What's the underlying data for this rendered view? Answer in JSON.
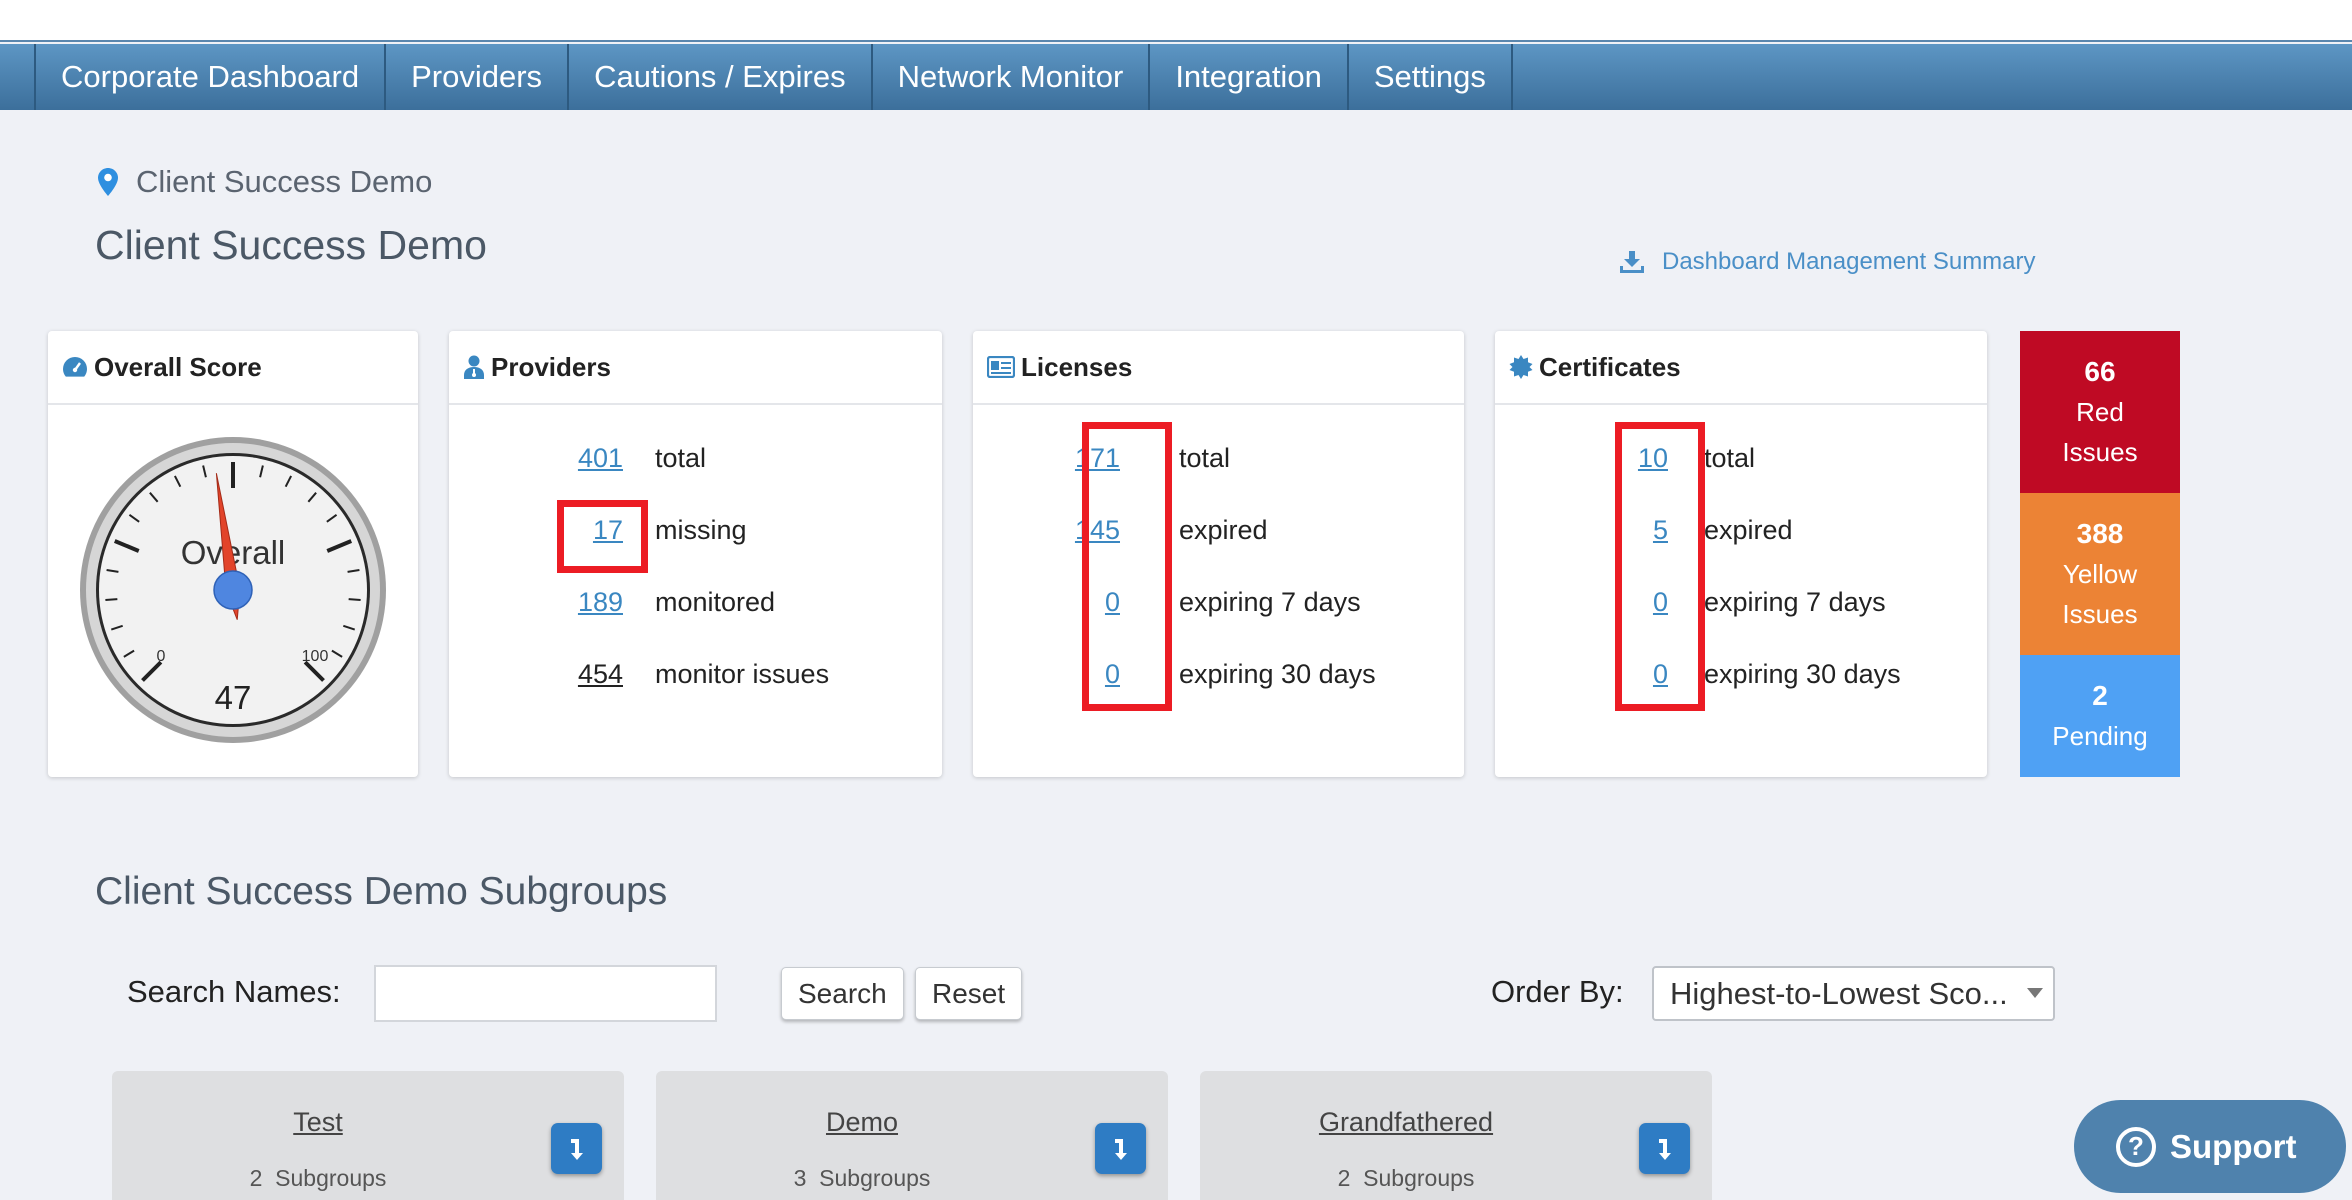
{
  "nav": [
    "Corporate Dashboard",
    "Providers",
    "Cautions / Expires",
    "Network Monitor",
    "Integration",
    "Settings"
  ],
  "breadcrumb": "Client Success Demo",
  "page_title": "Client Success Demo",
  "download_link": "Dashboard Management Summary",
  "overall": {
    "title": "Overall Score",
    "gauge_label": "Overall",
    "min_label": "0",
    "max_label": "100",
    "value": "47",
    "score": 47
  },
  "providers": {
    "title": "Providers",
    "rows": [
      {
        "num": "401",
        "label": "total"
      },
      {
        "num": "17",
        "label": "missing"
      },
      {
        "num": "189",
        "label": "monitored"
      },
      {
        "num": "454",
        "label": "monitor issues"
      }
    ]
  },
  "licenses": {
    "title": "Licenses",
    "rows": [
      {
        "num": "171",
        "label": "total"
      },
      {
        "num": "145",
        "label": "expired"
      },
      {
        "num": "0",
        "label": "expiring 7 days"
      },
      {
        "num": "0",
        "label": "expiring 30 days"
      }
    ]
  },
  "certificates": {
    "title": "Certificates",
    "rows": [
      {
        "num": "10",
        "label": "total"
      },
      {
        "num": "5",
        "label": "expired"
      },
      {
        "num": "0",
        "label": "expiring 7 days"
      },
      {
        "num": "0",
        "label": "expiring 30 days"
      }
    ]
  },
  "issues": {
    "red": {
      "count": "66",
      "line1": "Red",
      "line2": "Issues",
      "color": "#bf0a24"
    },
    "yellow": {
      "count": "388",
      "line1": "Yellow",
      "line2": "Issues",
      "color": "#ec8335"
    },
    "pending": {
      "count": "2",
      "line1": "Pending",
      "color": "#4fa1f4"
    }
  },
  "subgroups": {
    "title": "Client Success Demo Subgroups",
    "search_label": "Search Names:",
    "search_value": "",
    "search_button": "Search",
    "reset_button": "Reset",
    "order_label": "Order By:",
    "order_value": "Highest-to-Lowest Sco...",
    "items": [
      {
        "name": "Test",
        "count": "2",
        "unit": "Subgroups"
      },
      {
        "name": "Demo",
        "count": "3",
        "unit": "Subgroups"
      },
      {
        "name": "Grandfathered",
        "count": "2",
        "unit": "Subgroups"
      }
    ]
  },
  "support_label": "Support",
  "colors": {
    "nav": "#3c6f9b",
    "link": "#3a87c1",
    "highlight": "#ec1c24",
    "accent_blue": "#2e7cc4"
  }
}
